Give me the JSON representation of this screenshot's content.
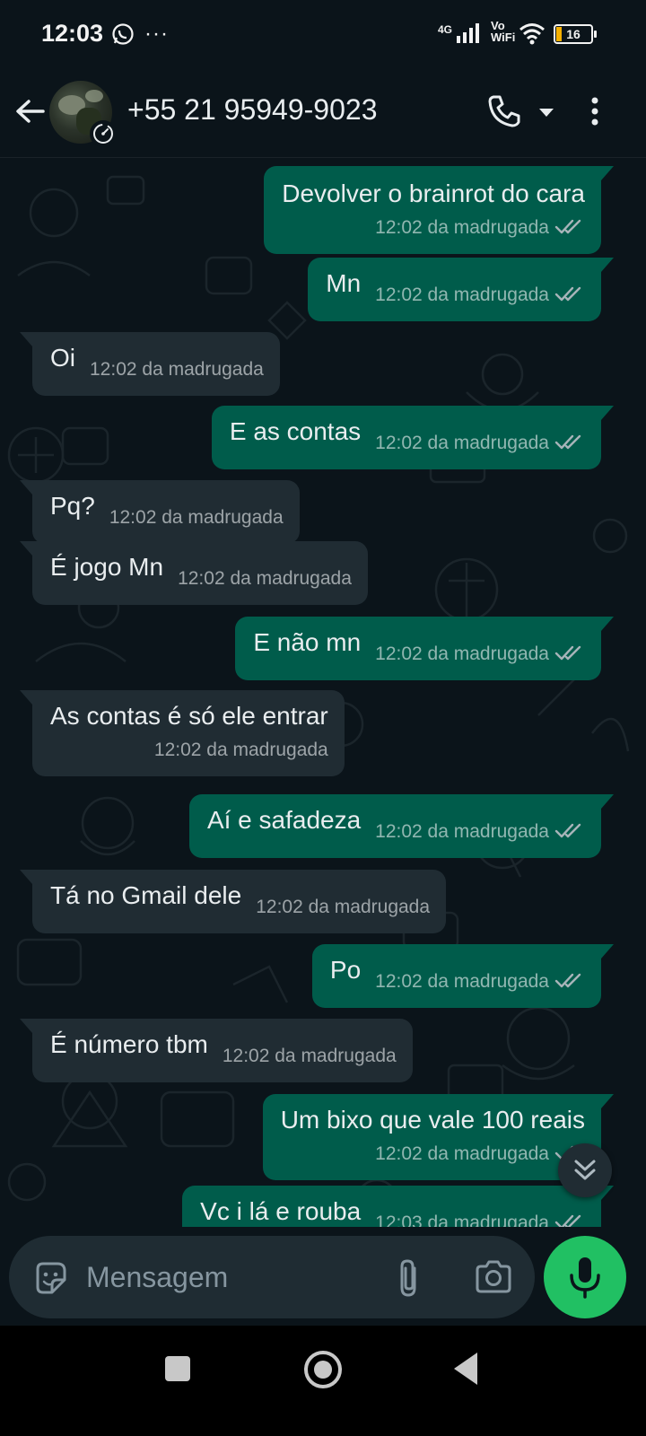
{
  "status_bar": {
    "time": "12:03",
    "more": "···",
    "network": "4G",
    "vowifi": "Vo\nWiFi",
    "battery_level": "16",
    "battery_fraction": 0.16
  },
  "header": {
    "contact_name": "+55 21 95949-9023"
  },
  "colors": {
    "outgoing_bubble": "#005c4b",
    "incoming_bubble": "#202c33",
    "accent_green": "#21c063",
    "read_ticks": "#a7b4b9"
  },
  "messages": [
    {
      "dir": "out",
      "text": "Devolver o brainrot do cara",
      "time": "12:02 da madrugada",
      "ticks": "double-check"
    },
    {
      "dir": "out",
      "text": "Mn",
      "time": "12:02 da madrugada",
      "ticks": "double-check"
    },
    {
      "dir": "in",
      "text": "Oi",
      "time": "12:02 da madrugada"
    },
    {
      "dir": "out",
      "text": "E as contas",
      "time": "12:02 da madrugada",
      "ticks": "double-check"
    },
    {
      "dir": "in",
      "text": "Pq?",
      "time": "12:02 da madrugada"
    },
    {
      "dir": "in",
      "text": "É jogo Mn",
      "time": "12:02 da madrugada"
    },
    {
      "dir": "out",
      "text": "E não mn",
      "time": "12:02 da madrugada",
      "ticks": "double-check"
    },
    {
      "dir": "in",
      "text": "As contas é só ele entrar",
      "time": "12:02 da madrugada"
    },
    {
      "dir": "out",
      "text": "Aí e safadeza",
      "time": "12:02 da madrugada",
      "ticks": "double-check"
    },
    {
      "dir": "in",
      "text": "Tá no Gmail dele",
      "time": "12:02 da madrugada"
    },
    {
      "dir": "out",
      "text": "Po",
      "time": "12:02 da madrugada",
      "ticks": "double-check"
    },
    {
      "dir": "in",
      "text": "É número tbm",
      "time": "12:02 da madrugada"
    },
    {
      "dir": "out",
      "text": "Um bixo que vale 100 reais",
      "time": "12:02 da madrugada",
      "ticks": "double-check"
    },
    {
      "dir": "out",
      "text": "Vc i lá e rouba",
      "time": "12:03 da madrugada",
      "ticks": "double-check"
    }
  ],
  "input": {
    "placeholder": "Mensagem"
  },
  "icons": {
    "back": "arrow-left-icon",
    "call": "phone-icon",
    "call_dropdown": "caret-down-icon",
    "menu": "kebab-menu-icon",
    "sticker": "sticker-icon",
    "attach": "paperclip-icon",
    "camera": "camera-icon",
    "mic": "microphone-icon",
    "scroll_down": "double-chevron-down-icon",
    "disappearing_timer": "timer-icon"
  }
}
